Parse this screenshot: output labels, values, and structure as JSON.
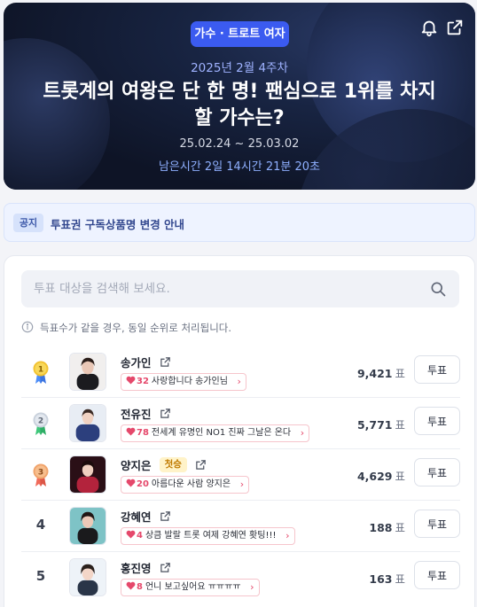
{
  "hero": {
    "category": "가수 · 트로트 여자",
    "week": "2025년 2월 4주차",
    "title": "트롯계의 여왕은 단 한 명! 팬심으로 1위를 차지할 가수는?",
    "period": "25.02.24 ~ 25.03.02",
    "remaining": "남은시간 2일 14시간 21분 20초",
    "icons": [
      "bell-icon",
      "share-icon"
    ]
  },
  "notice": {
    "tag": "공지",
    "text": "투표권 구독상품명 변경 안내"
  },
  "search": {
    "placeholder": "투표 대상을 검색해 보세요."
  },
  "info": {
    "text": "득표수가 같을 경우, 동일 순위로 처리됩니다."
  },
  "ranking": {
    "vote_unit": "표",
    "vote_button": "투표",
    "first_badge": "첫승",
    "items": [
      {
        "rank": "1",
        "medal": "gold",
        "name": "송가인",
        "badge": "",
        "cheer_count": "32",
        "cheer_text": "사랑합니다 송가인님",
        "votes": "9,421"
      },
      {
        "rank": "2",
        "medal": "silver",
        "name": "전유진",
        "badge": "",
        "cheer_count": "78",
        "cheer_text": "전세계 유명인 NO1 진짜 그날은 온다",
        "votes": "5,771"
      },
      {
        "rank": "3",
        "medal": "bronze",
        "name": "양지은",
        "badge": "첫승",
        "cheer_count": "20",
        "cheer_text": "아름다운 사람 양지은",
        "votes": "4,629"
      },
      {
        "rank": "4",
        "medal": "",
        "name": "강혜연",
        "badge": "",
        "cheer_count": "4",
        "cheer_text": "상큼 발랄 트롯 여제 강혜연 홧팅!!!",
        "votes": "188"
      },
      {
        "rank": "5",
        "medal": "",
        "name": "홍진영",
        "badge": "",
        "cheer_count": "8",
        "cheer_text": "언니 보고싶어요 ㅠㅠㅠㅠ",
        "votes": "163"
      }
    ]
  },
  "colors": {
    "accent": "#3b5bf0",
    "heart": "#e5486b",
    "gold": "#f2c230",
    "silver": "#c9d1dc",
    "bronze": "#f0a36b"
  }
}
